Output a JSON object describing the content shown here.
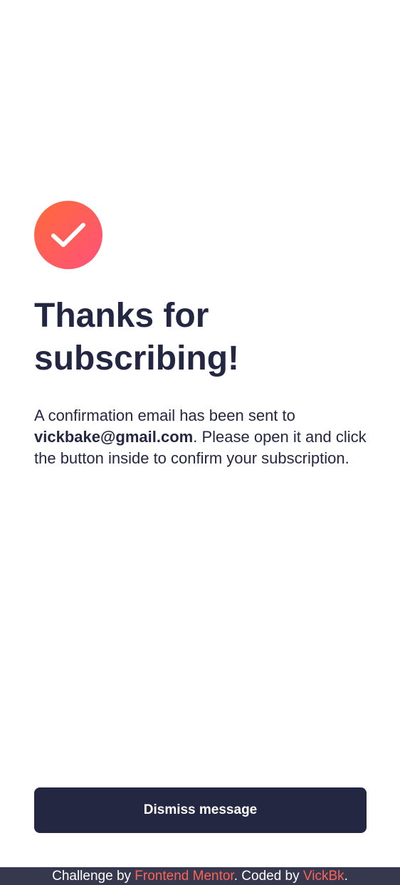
{
  "success": {
    "icon": "checkmark-icon",
    "title": "Thanks for subscribing!",
    "message_prefix": "A confirmation email has been sent to ",
    "email": "vickbake@gmail.com",
    "message_suffix": ". Please open it and click the button inside to confirm your subscription.",
    "dismiss_label": "Dismiss message"
  },
  "attribution": {
    "prefix": "Challenge by ",
    "challenge_link": "Frontend Mentor",
    "middle": ". Coded by ",
    "author_link": "VickBk",
    "suffix": "."
  },
  "colors": {
    "icon_gradient_start": "#ff6a3a",
    "icon_gradient_end": "#ff527b",
    "text_dark": "#242742",
    "button_bg": "#242742",
    "footer_bg": "#36384d",
    "link": "#ff6257"
  }
}
